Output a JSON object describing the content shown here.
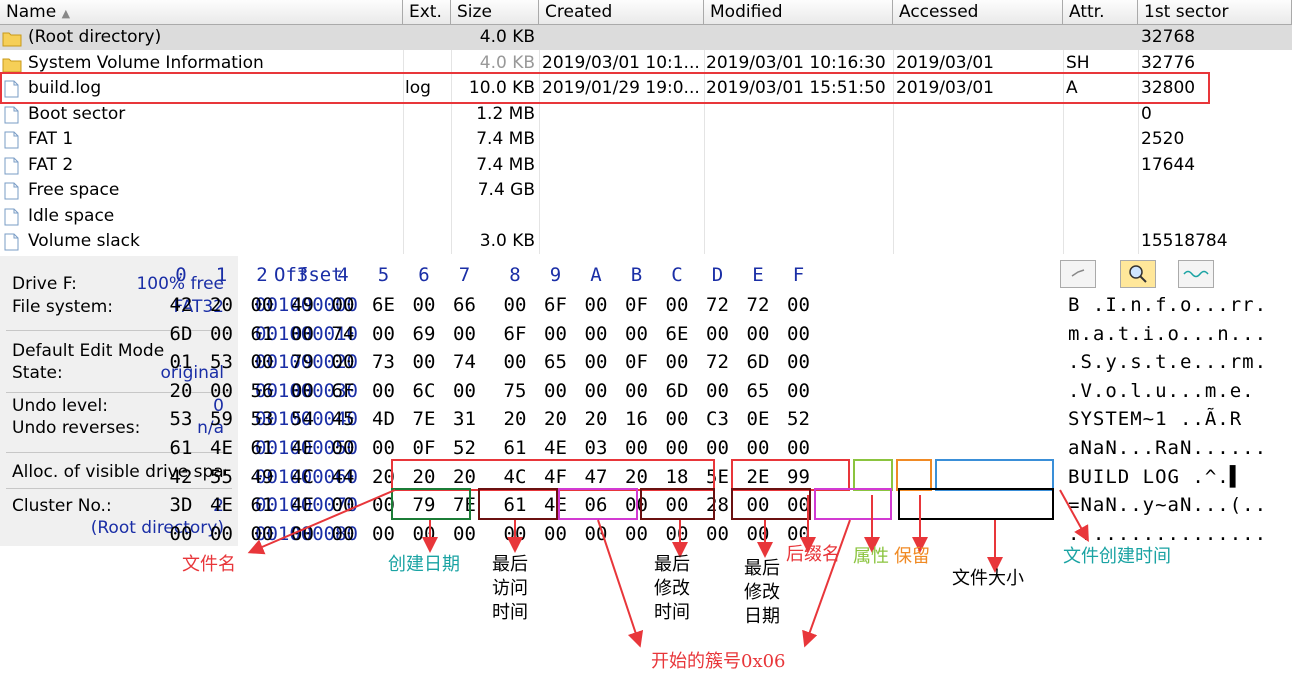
{
  "columns": {
    "name": "Name",
    "ext": "Ext.",
    "size": "Size",
    "created": "Created",
    "modified": "Modified",
    "accessed": "Accessed",
    "attr": "Attr.",
    "first_sector": "1st sector",
    "sort_arrow": "▲"
  },
  "files": [
    {
      "name": "(Root directory)",
      "ext": "",
      "size": "4.0 KB",
      "created": "",
      "modified": "",
      "accessed": "",
      "attr": "",
      "first_sector": "32768",
      "icon": "folder-icon",
      "selected": true
    },
    {
      "name": "System Volume Information",
      "ext": "",
      "size": "4.0 KB",
      "created": "2019/03/01  10:1...",
      "modified": "2019/03/01  10:16:30",
      "accessed": "2019/03/01",
      "attr": "SH",
      "first_sector": "32776",
      "icon": "folder-icon",
      "grey_size": true
    },
    {
      "name": "build.log",
      "ext": "log",
      "size": "10.0 KB",
      "created": "2019/01/29  19:0...",
      "modified": "2019/03/01  15:51:50",
      "accessed": "2019/03/01",
      "attr": "A",
      "first_sector": "32800",
      "icon": "file-icon",
      "highlighted": true
    },
    {
      "name": "Boot sector",
      "ext": "",
      "size": "1.2 MB",
      "created": "",
      "modified": "",
      "accessed": "",
      "attr": "",
      "first_sector": "0",
      "icon": "file-icon"
    },
    {
      "name": "FAT 1",
      "ext": "",
      "size": "7.4 MB",
      "created": "",
      "modified": "",
      "accessed": "",
      "attr": "",
      "first_sector": "2520",
      "icon": "file-icon"
    },
    {
      "name": "FAT 2",
      "ext": "",
      "size": "7.4 MB",
      "created": "",
      "modified": "",
      "accessed": "",
      "attr": "",
      "first_sector": "17644",
      "icon": "file-icon"
    },
    {
      "name": "Free space",
      "ext": "",
      "size": "7.4 GB",
      "created": "",
      "modified": "",
      "accessed": "",
      "attr": "",
      "first_sector": "",
      "icon": "file-icon"
    },
    {
      "name": "Idle space",
      "ext": "",
      "size": "",
      "created": "",
      "modified": "",
      "accessed": "",
      "attr": "",
      "first_sector": "",
      "icon": "file-icon"
    },
    {
      "name": "Volume slack",
      "ext": "",
      "size": "3.0 KB",
      "created": "",
      "modified": "",
      "accessed": "",
      "attr": "",
      "first_sector": "15518784",
      "icon": "file-icon"
    }
  ],
  "panel": {
    "drive_label": "Drive F:",
    "drive_value": "100% free",
    "fs_label": "File system:",
    "fs_value": "FAT32",
    "mode_label": "Default Edit Mode",
    "state_label": "State:",
    "state_value": "original",
    "undo_label": "Undo level:",
    "undo_value": "0",
    "undo_rev_label": "Undo reverses:",
    "undo_rev_value": "n/a",
    "alloc_label": "Alloc. of visible drive space:",
    "cluster_label": "Cluster No.:",
    "cluster_value": "2",
    "cluster_name": "(Root directory)"
  },
  "hex": {
    "offset_header": "Offset",
    "columns": [
      "0",
      "1",
      "2",
      "3",
      "4",
      "5",
      "6",
      "7",
      "8",
      "9",
      "A",
      "B",
      "C",
      "D",
      "E",
      "F"
    ],
    "rows": [
      {
        "offset": "001000000",
        "bytes": [
          "42",
          "20",
          "00",
          "49",
          "00",
          "6E",
          "00",
          "66",
          "00",
          "6F",
          "00",
          "0F",
          "00",
          "72",
          "72",
          "00"
        ],
        "ascii": "B .I.n.f.o...rr."
      },
      {
        "offset": "001000010",
        "bytes": [
          "6D",
          "00",
          "61",
          "00",
          "74",
          "00",
          "69",
          "00",
          "6F",
          "00",
          "00",
          "00",
          "6E",
          "00",
          "00",
          "00"
        ],
        "ascii": "m.a.t.i.o...n..."
      },
      {
        "offset": "001000020",
        "bytes": [
          "01",
          "53",
          "00",
          "79",
          "00",
          "73",
          "00",
          "74",
          "00",
          "65",
          "00",
          "0F",
          "00",
          "72",
          "6D",
          "00"
        ],
        "ascii": ".S.y.s.t.e...rm."
      },
      {
        "offset": "001000030",
        "bytes": [
          "20",
          "00",
          "56",
          "00",
          "6F",
          "00",
          "6C",
          "00",
          "75",
          "00",
          "00",
          "00",
          "6D",
          "00",
          "65",
          "00"
        ],
        "ascii": " .V.o.l.u...m.e."
      },
      {
        "offset": "001000040",
        "bytes": [
          "53",
          "59",
          "53",
          "54",
          "45",
          "4D",
          "7E",
          "31",
          "20",
          "20",
          "20",
          "16",
          "00",
          "C3",
          "0E",
          "52"
        ],
        "ascii": "SYSTEM~1   ..Ã.R"
      },
      {
        "offset": "001000050",
        "bytes": [
          "61",
          "4E",
          "61",
          "4E",
          "00",
          "00",
          "0F",
          "52",
          "61",
          "4E",
          "03",
          "00",
          "00",
          "00",
          "00",
          "00"
        ],
        "ascii": "aNaN...RaN......"
      },
      {
        "offset": "001000060",
        "bytes": [
          "42",
          "55",
          "49",
          "4C",
          "44",
          "20",
          "20",
          "20",
          "4C",
          "4F",
          "47",
          "20",
          "18",
          "5E",
          "2E",
          "99"
        ],
        "ascii": "BUILD   LOG .^.▌"
      },
      {
        "offset": "001000070",
        "bytes": [
          "3D",
          "4E",
          "61",
          "4E",
          "00",
          "00",
          "79",
          "7E",
          "61",
          "4E",
          "06",
          "00",
          "00",
          "28",
          "00",
          "00"
        ],
        "ascii": "=NaN..y~aN...(.."
      },
      {
        "offset": "001000080",
        "bytes": [
          "00",
          "00",
          "00",
          "00",
          "00",
          "00",
          "00",
          "00",
          "00",
          "00",
          "00",
          "00",
          "00",
          "00",
          "00",
          "00"
        ],
        "ascii": "................"
      }
    ]
  },
  "annotations": {
    "filename": "文件名",
    "create_date": "创建日期",
    "last_access": "最后\n访问\n时间",
    "last_modify_time": "最后\n修改\n时间",
    "last_modify_date": "最后\n修改\n日期",
    "ext": "后缀名",
    "attr": "属性",
    "reserved": "保留",
    "filesize": "文件大小",
    "create_time": "文件创建时间",
    "start_cluster": "开始的簇号0x06"
  },
  "colors": {
    "red": "#e8363a",
    "teal": "#1aa3a3",
    "green": "#8bc43f",
    "orange": "#f08a24",
    "blue": "#3a8fd8",
    "darkred": "#6b1010",
    "magenta": "#d23ad2",
    "black": "#000000",
    "hex_blue": "#1a2ea6"
  }
}
